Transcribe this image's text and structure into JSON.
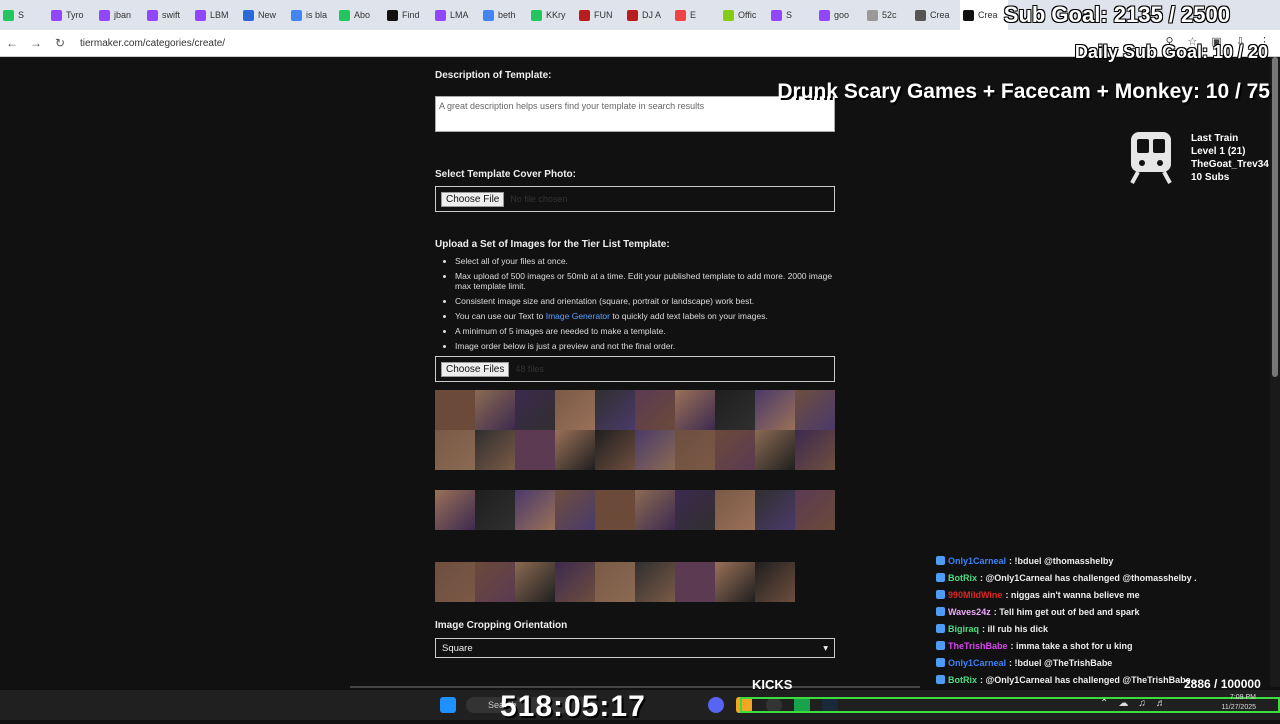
{
  "browser": {
    "tabs": [
      {
        "label": "S",
        "color": "#22c55e"
      },
      {
        "label": "Tyro",
        "color": "#9146ff"
      },
      {
        "label": "jban",
        "color": "#9146ff"
      },
      {
        "label": "swift",
        "color": "#9146ff"
      },
      {
        "label": "LBM",
        "color": "#9146ff"
      },
      {
        "label": "New",
        "color": "#2a6ad8"
      },
      {
        "label": "is bla",
        "color": "#4285f4"
      },
      {
        "label": "Abo",
        "color": "#22c55e"
      },
      {
        "label": "Find",
        "color": "#111111"
      },
      {
        "label": "LMA",
        "color": "#9146ff"
      },
      {
        "label": "beth",
        "color": "#4285f4"
      },
      {
        "label": "KKry",
        "color": "#22c55e"
      },
      {
        "label": "FUN",
        "color": "#b91c1c"
      },
      {
        "label": "DJ A",
        "color": "#b91c1c"
      },
      {
        "label": "E",
        "color": "#ef4444"
      },
      {
        "label": "Offic",
        "color": "#84cc16"
      },
      {
        "label": "S",
        "color": "#9146ff"
      },
      {
        "label": "goo",
        "color": "#9146ff"
      },
      {
        "label": "52c",
        "color": "#999999"
      },
      {
        "label": "Crea",
        "color": "#555555"
      },
      {
        "label": "Crea",
        "color": "#111111"
      }
    ],
    "url": "tiermaker.com/categories/create/"
  },
  "form": {
    "description_label": "Description of Template:",
    "description_placeholder": "A great description helps users find your template in search results",
    "cover_label": "Select Template Cover Photo:",
    "choose_file": "Choose File",
    "no_file": "No file chosen",
    "upload_label": "Upload a Set of Images for the Tier List Template:",
    "rules": [
      {
        "text": "Select all of your files at once."
      },
      {
        "text": "Max upload of 500 images or 50mb at a time. Edit your published template to add more. 2000 image max template limit."
      },
      {
        "text": "Consistent image size and orientation (square, portrait or landscape) work best."
      },
      {
        "pre": "You can use our Text to ",
        "link": "Image Generator",
        "post": " to quickly add text labels on your images."
      },
      {
        "text": "A minimum of 5 images are needed to make a template."
      },
      {
        "text": "Image order below is just a preview and not the final order."
      }
    ],
    "choose_files": "Choose Files",
    "files_count": "48 files",
    "cropping_label": "Image Cropping Orientation",
    "cropping_value": "Square"
  },
  "overlay": {
    "sub_goal": "Sub Goal: 2135 / 2500",
    "daily_goal": "Daily Sub Goal: 10 / 20",
    "drunk": "Drunk Scary Games + Facecam + Monkey:  10 / 75",
    "last_train": [
      "Last Train",
      "Level 1  (21)",
      "TheGoat_Trev34",
      "10 Subs"
    ],
    "kicks": "KICKS",
    "kicks_count": "2886  / 100000",
    "timer": "518:05:17"
  },
  "chat": [
    {
      "user": "Only1Carneal",
      "color": "#3b82f6",
      "msg": ": !bduel @thomasshelby"
    },
    {
      "user": "BotRix",
      "color": "#4ade80",
      "msg": ": @Only1Carneal has challenged @thomasshelby ."
    },
    {
      "user": "990MildWine",
      "color": "#dc2626",
      "msg": ": niggas ain't wanna believe me"
    },
    {
      "user": "Waves24z",
      "color": "#f0abfc",
      "msg": ": Tell him get out of bed and spark"
    },
    {
      "user": "Bigiraq",
      "color": "#4ade80",
      "msg": ": ill rub his dick"
    },
    {
      "user": "TheTrishBabe",
      "color": "#d946ef",
      "msg": ": imma take a shot for u king"
    },
    {
      "user": "Only1Carneal",
      "color": "#3b82f6",
      "msg": ": !bduel @TheTrishBabe"
    },
    {
      "user": "BotRix",
      "color": "#4ade80",
      "msg": ": @Only1Carneal has challenged @TheTrishBabe ."
    }
  ],
  "taskbar": {
    "search": "Search",
    "time": "7:09 PM",
    "date": "11/27/2025"
  }
}
